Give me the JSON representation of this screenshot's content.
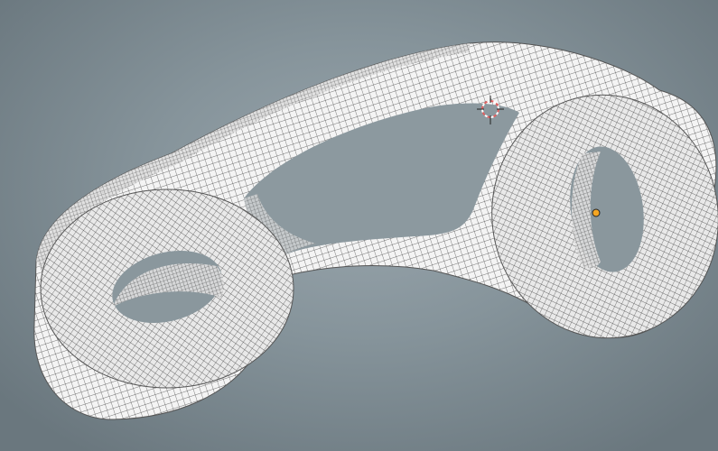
{
  "viewport": {
    "mode": "3d-viewport",
    "display": "wireframe-over-solid",
    "object": "mesh-link-part"
  },
  "colors": {
    "background_center": "#9aa6ad",
    "background_edge": "#6a777e",
    "mesh_surface": "#f4f4f4",
    "mesh_wire": "#3a3a3a",
    "origin_point": "#f5a623",
    "cursor_ring": "#e06060"
  },
  "icons": {
    "cursor": "3d-cursor-icon",
    "origin": "object-origin-icon"
  }
}
